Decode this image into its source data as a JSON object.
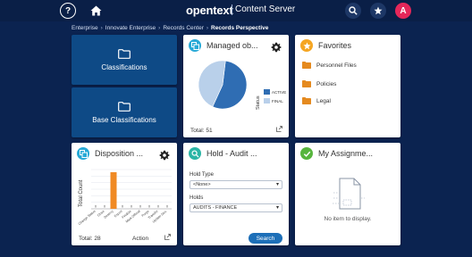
{
  "header": {
    "help_label": "?",
    "brand": "opentext",
    "product": "Content Server",
    "avatar_initial": "A"
  },
  "breadcrumb": [
    {
      "label": "Enterprise"
    },
    {
      "label": "Innovate Enterprise"
    },
    {
      "label": "Records Center"
    },
    {
      "label": "Records Perspective"
    }
  ],
  "nav_tiles": {
    "classifications": "Classifications",
    "base_classifications": "Base Classifications"
  },
  "managed": {
    "title": "Managed ob...",
    "total": "Total: 51",
    "status_label": "Status",
    "legend": [
      {
        "label": "ACTIVE",
        "color": "#2f6db3"
      },
      {
        "label": "FINAL",
        "color": "#b9d0ea"
      }
    ]
  },
  "chart_data": {
    "type": "pie",
    "categories": [
      "ACTIVE",
      "FINAL"
    ],
    "values": [
      28,
      23
    ],
    "colors": [
      "#2f6db3",
      "#b9d0ea"
    ],
    "legend_title": "Status"
  },
  "favorites": {
    "title": "Favorites",
    "items": [
      {
        "label": "Personnel Files"
      },
      {
        "label": "Policies"
      },
      {
        "label": "Legal"
      }
    ]
  },
  "disposition": {
    "title": "Disposition ...",
    "y_label": "Total Count",
    "x_label": "Action",
    "total": "Total: 28",
    "bar_color": "#f08a24",
    "bars": [
      {
        "label": "Change Status",
        "value": 0
      },
      {
        "label": "Close",
        "value": 0
      },
      {
        "label": "Destroy",
        "value": 28
      },
      {
        "label": "Export",
        "value": 0
      },
      {
        "label": "Finalize",
        "value": 0
      },
      {
        "label": "Mark Official",
        "value": 0
      },
      {
        "label": "Purge",
        "value": 0
      },
      {
        "label": "Transfer",
        "value": 0
      },
      {
        "label": "Update Stor.",
        "value": 0
      }
    ],
    "zero_label": "0"
  },
  "hold": {
    "title": "Hold - Audit ...",
    "hold_type_label": "Hold Type",
    "hold_type_value": "<None>",
    "holds_label": "Holds",
    "holds_value": "AUDITS - FINANCE",
    "search_label": "Search"
  },
  "assignments": {
    "title": "My Assignme...",
    "empty_text": "No item to display."
  }
}
